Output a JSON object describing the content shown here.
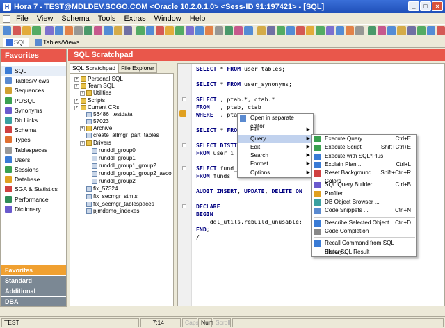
{
  "window": {
    "title": "Hora 7 - TEST@MDLDEV.SCGO.COM   <Oracle 10.2.0.1.0>   <Sess-ID 91:197421> - [SQL]",
    "controls": [
      "_",
      "□",
      "×"
    ]
  },
  "menubar": [
    "File",
    "View",
    "Schema",
    "Tools",
    "Extras",
    "Window",
    "Help"
  ],
  "viewsbar": {
    "sql_label": "SQL",
    "tables_label": "Tables/Views"
  },
  "favorites": {
    "title": "Favorites",
    "items": [
      "SQL",
      "Tables/Views",
      "Sequences",
      "PL/SQL",
      "Synonyms",
      "Db Links",
      "Schema",
      "Types",
      "Tablespaces",
      "Users",
      "Sessions",
      "Database",
      "SGA & Statistics",
      "Performance",
      "Dictionary"
    ],
    "groups": [
      "Favorites",
      "Standard",
      "Additional",
      "DBA"
    ]
  },
  "main": {
    "title": "SQL Scratchpad"
  },
  "tabs": [
    "SQL Scratchpad",
    "File Explorer"
  ],
  "tree": [
    "Personal SQL",
    "Team SQL",
    "Utilities",
    "Scripts",
    "Current CRs",
    "56486_testdata",
    "57023",
    "Archive",
    "create_allmgr_part_tables",
    "Drivers",
    "runddl_group0",
    "runddl_group1",
    "runddl_group1_group2",
    "runddl_group1_group2_asco",
    "runddl_group2",
    "fix_57324",
    "fix_secmgr_stmts",
    "fix_secmgr_tablespaces",
    "pjmdemo_indexes"
  ],
  "code": [
    "SELECT * FROM user_tables;",
    "SELECT * FROM user_synonyms;",
    "SELECT , ptab.*, ctab.*",
    "FROM   , ptab, ctab",
    "WHERE  , ptab.pid (+) = ctab.pid;",
    "SELECT * FROM",
    "SELECT DISTI",
    "FROM user_i",
    "SELECT fund_",
    "FROM funds_",
    "AUDIT INSERT, UPDATE, DELETE ON",
    "DECLARE",
    "BEGIN",
    "    ddl_utils.rebuild_unusable;",
    "END;",
    "/"
  ],
  "context_menu": {
    "items": [
      "Open in separate editor",
      "File",
      "Query",
      "Edit",
      "Search",
      "Format",
      "Options"
    ]
  },
  "query_submenu": {
    "items": [
      {
        "label": "Execute Query",
        "shortcut": "Ctrl+E"
      },
      {
        "label": "Execute Script",
        "shortcut": "Shift+Ctrl+E"
      },
      {
        "label": "Execute with SQL*Plus",
        "shortcut": ""
      },
      {
        "label": "Explain Plan ...",
        "shortcut": "Ctrl+L"
      },
      {
        "label": "Reset Background Colors",
        "shortcut": "Shift+Ctrl+R"
      },
      {
        "label": "SQL Query Builder ...",
        "shortcut": "Ctrl+B"
      },
      {
        "label": "Profiler ...",
        "shortcut": ""
      },
      {
        "label": "DB Object Browser ...",
        "shortcut": ""
      },
      {
        "label": "Code Snippets ...",
        "shortcut": "Ctrl+N"
      },
      {
        "label": "Describe Selected Object",
        "shortcut": "Ctrl+D"
      },
      {
        "label": "Code Completion",
        "shortcut": ""
      },
      {
        "label": "Recall Command from SQL History ...",
        "shortcut": ""
      },
      {
        "label": "Show SQL Result",
        "shortcut": ""
      }
    ]
  },
  "statusbar": {
    "connection": "TEST",
    "position": "7:14",
    "caps": "Caps",
    "num": "Num",
    "scroll": "Scroll"
  },
  "colors": {
    "header": "#e9574b",
    "titlebar": "#1f4fb8",
    "keyword": "#000080",
    "menu_highlight": "#c1d2ee"
  }
}
